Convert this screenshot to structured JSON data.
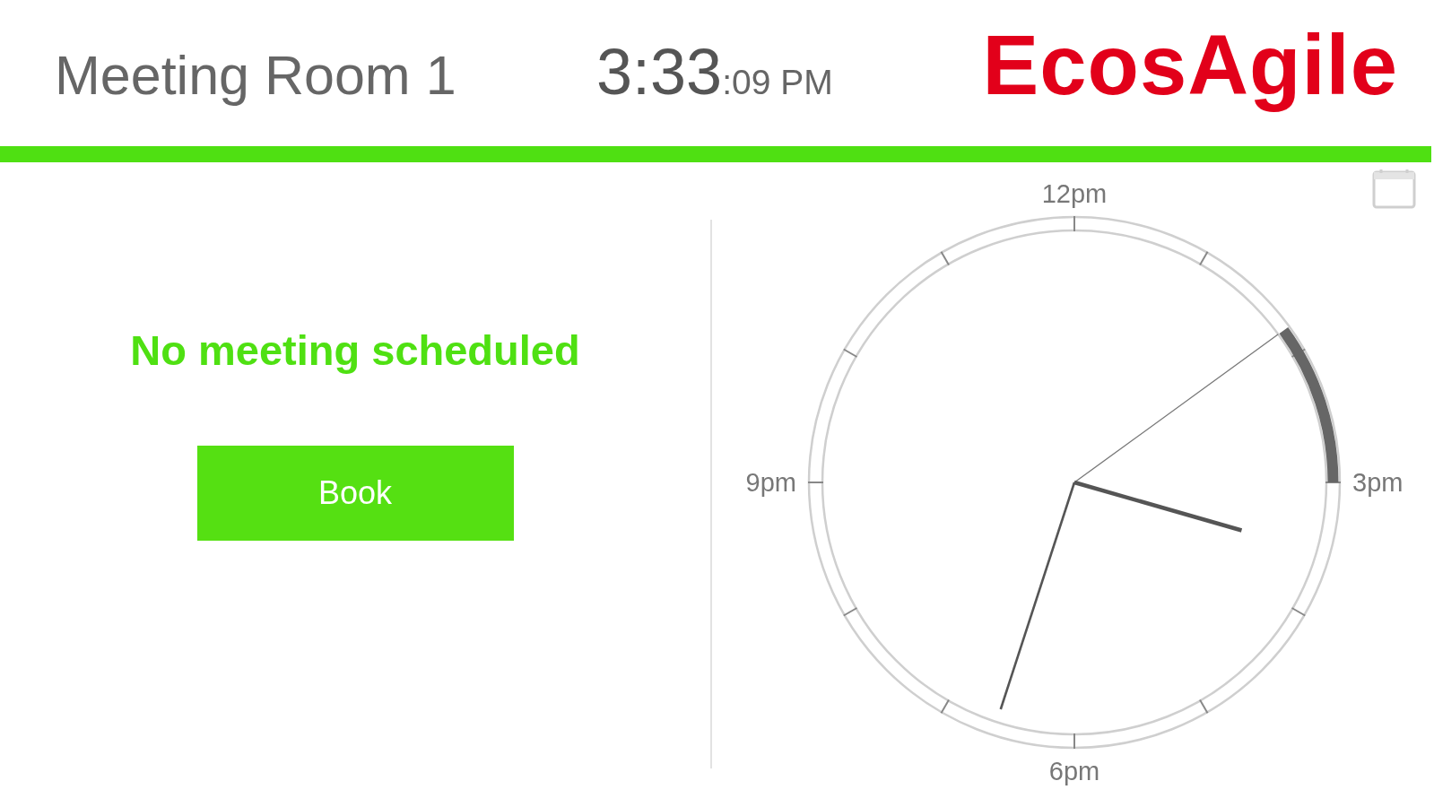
{
  "header": {
    "room_name": "Meeting Room 1",
    "time": "3:33",
    "time_small": ":09 PM",
    "logo": "EcosAgile"
  },
  "status": {
    "message": "No meeting scheduled",
    "button": "Book"
  },
  "clock": {
    "labels": [
      "12pm",
      "3pm",
      "6pm",
      "9pm"
    ]
  }
}
